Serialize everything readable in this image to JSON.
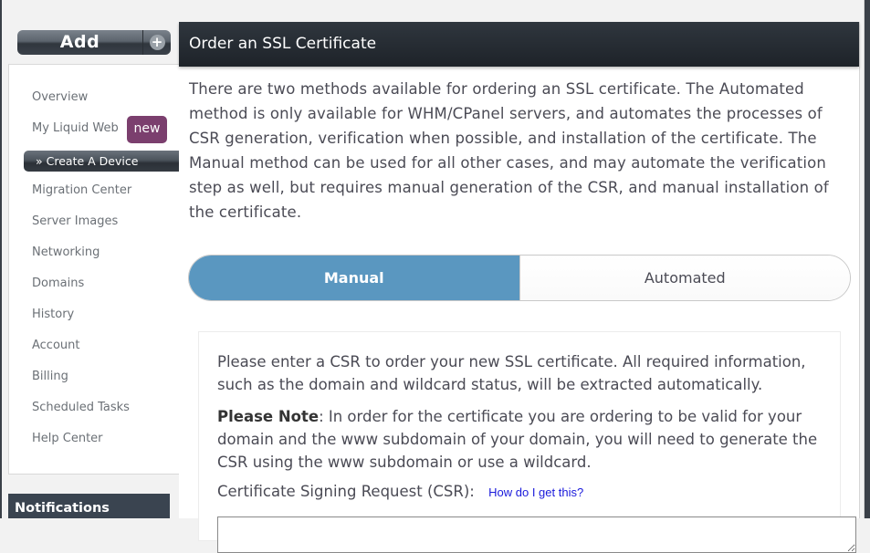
{
  "sidebar": {
    "add_label": "Add",
    "add_icon": "plus-icon",
    "items": [
      {
        "label": "Overview"
      },
      {
        "label": "My Liquid Web",
        "badge": "new"
      },
      {
        "label": "» Create A Device",
        "active": true
      },
      {
        "label": "Migration Center"
      },
      {
        "label": "Server Images"
      },
      {
        "label": "Networking"
      },
      {
        "label": "Domains"
      },
      {
        "label": "History"
      },
      {
        "label": "Account"
      },
      {
        "label": "Billing"
      },
      {
        "label": "Scheduled Tasks"
      },
      {
        "label": "Help Center"
      }
    ],
    "notifications_title": "Notifications",
    "badge_color": "#7b3f6e"
  },
  "main": {
    "title": "Order an SSL Certificate",
    "intro": "There are two methods available for ordering an SSL certificate. The Automated method is only available for WHM/CPanel servers, and automates the processes of CSR generation, verification when possible, and installation of the certificate. The Manual method can be used for all other cases, and may automate the verification step as well, but requires manual generation of the CSR, and manual installation of the certificate.",
    "toggle": {
      "options": [
        "Manual",
        "Automated"
      ],
      "selected": "Manual",
      "active_color": "#5a97c0"
    },
    "card": {
      "paragraph1": "Please enter a CSR to order your new SSL certificate. All required information, such as the domain and wildcard status, will be extracted automatically.",
      "note_label": "Please Note",
      "note_text": ": In order for the certificate you are ordering to be valid for your domain and the www subdomain of your domain, you will need to generate the CSR using the www subdomain or use a wildcard.",
      "csr_label": "Certificate Signing Request (CSR):",
      "help_link": "How do I get this?",
      "csr_value": ""
    }
  }
}
